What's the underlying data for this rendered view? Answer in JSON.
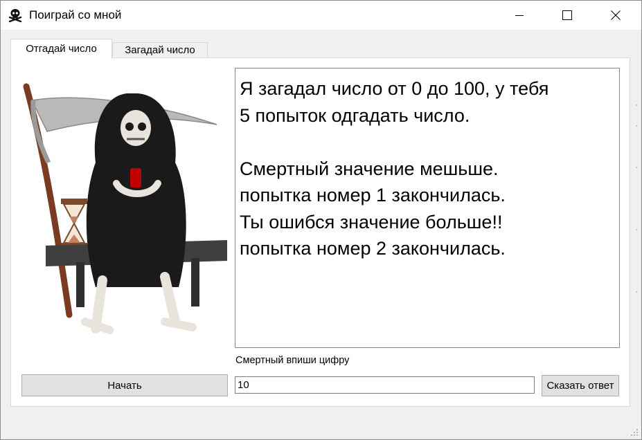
{
  "window": {
    "title": "Поиграй со мной",
    "app_icon": "skull-crossbones-icon",
    "controls": [
      "minimize-icon",
      "maximize-icon",
      "close-icon"
    ]
  },
  "tabs": [
    {
      "label": "Отгадай число",
      "active": true
    },
    {
      "label": "Загадай число",
      "active": false
    }
  ],
  "game": {
    "image": "grim-reaper-illustration",
    "output_lines": [
      "Я загадал число от 0 до 100, у тебя",
      "5 попыток одгадать число.",
      "",
      "Смертный значение мешьше.",
      "попытка номер 1 закончилась.",
      "Ты ошибся значение больше!!",
      "попытка номер 2 закончилась."
    ],
    "prompt_label": "Смертный впиши цифру",
    "start_button": "Начать",
    "answer_value": "10",
    "answer_button": "Сказать ответ"
  }
}
